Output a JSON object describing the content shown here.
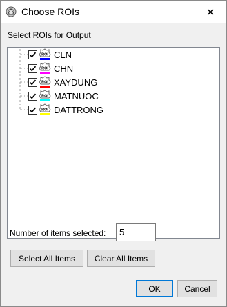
{
  "window": {
    "title": "Choose ROIs",
    "close_label": "✕"
  },
  "section_label": "Select ROIs for Output",
  "roi_items": [
    {
      "name": "CLN",
      "color": "#0000ff",
      "checked": true
    },
    {
      "name": "CHN",
      "color": "#ff00ff",
      "checked": true
    },
    {
      "name": "XAYDUNG",
      "color": "#ff0000",
      "checked": true
    },
    {
      "name": "MATNUOC",
      "color": "#00ffff",
      "checked": true
    },
    {
      "name": "DATTRONG",
      "color": "#ffff00",
      "checked": true
    }
  ],
  "roi_icon_text": "ROI",
  "count": {
    "label": "Number of items selected:",
    "value": "5"
  },
  "buttons": {
    "select_all": "Select All Items",
    "clear_all": "Clear All Items",
    "ok": "OK",
    "cancel": "Cancel"
  }
}
